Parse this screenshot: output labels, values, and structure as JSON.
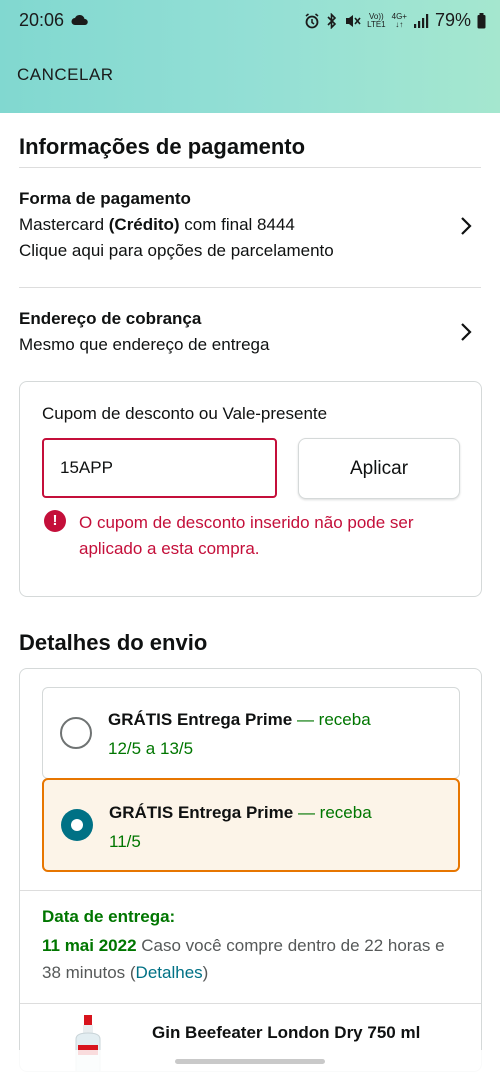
{
  "status_bar": {
    "time": "20:06",
    "battery": "79%",
    "volte_line1": "Vo))",
    "volte_line2": "LTE1",
    "network": "4G+"
  },
  "header": {
    "cancel_label": "CANCELAR"
  },
  "payment_section": {
    "title": "Informações de pagamento",
    "payment_method": {
      "title": "Forma de pagamento",
      "card_prefix": "Mastercard ",
      "card_type": "(Crédito)",
      "card_suffix": " com final 8444",
      "installments_text": "Clique aqui para opções de parcelamento"
    },
    "billing_address": {
      "title": "Endereço de cobrança",
      "value": "Mesmo que endereço de entrega"
    },
    "coupon": {
      "label": "Cupom de desconto ou Vale-presente",
      "input_value": "15APP",
      "apply_label": "Aplicar",
      "error_icon": "!",
      "error_message": "O cupom de desconto inserido não pode ser aplicado a esta compra."
    }
  },
  "shipping_section": {
    "title": "Detalhes do envio",
    "options": [
      {
        "name": "GRÁTIS Entrega Prime",
        "separator": " — receba",
        "dates": "12/5 a 13/5",
        "selected": false
      },
      {
        "name": "GRÁTIS Entrega Prime",
        "separator": " — receba",
        "dates": "11/5",
        "selected": true
      }
    ],
    "delivery": {
      "label": "Data de entrega:",
      "date": "11 mai 2022",
      "condition": " Caso você compre dentro de 22 horas e 38 minutos (",
      "details_link": "Detalhes",
      "close_paren": ")"
    },
    "product": {
      "name": "Gin Beefeater London Dry 750 ml"
    }
  },
  "colors": {
    "header_gradient_start": "#81d8d0",
    "header_gradient_end": "#a5e7cf",
    "error": "#c40f3a",
    "delivery_green": "#007600",
    "link_teal": "#007185",
    "selected_border": "#e77600"
  }
}
